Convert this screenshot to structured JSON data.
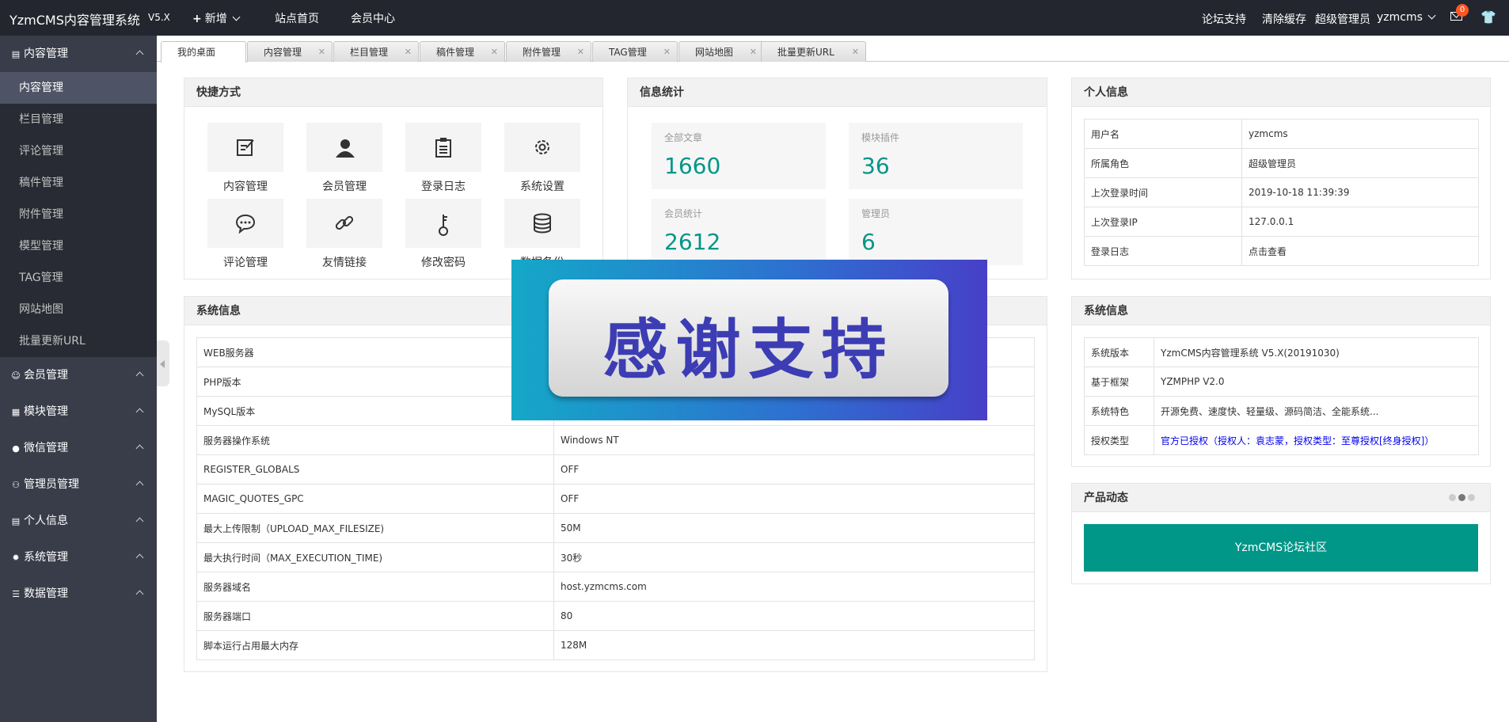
{
  "header": {
    "brand": "YzmCMS内容管理系统",
    "version": "V5.X",
    "nav": [
      "新增",
      "站点首页",
      "会员中心"
    ],
    "right": {
      "forum": "论坛支持",
      "clear_cache": "清除缓存",
      "role": "超级管理员",
      "user": "yzmcms",
      "mail_count": "0"
    }
  },
  "sidebar": {
    "groups": [
      {
        "label": "内容管理",
        "icon": "document-icon"
      },
      {
        "label": "会员管理",
        "icon": "user-icon"
      },
      {
        "label": "模块管理",
        "icon": "grid-icon"
      },
      {
        "label": "微信管理",
        "icon": "wechat-icon"
      },
      {
        "label": "管理员管理",
        "icon": "admin-icon"
      },
      {
        "label": "个人信息",
        "icon": "card-icon"
      },
      {
        "label": "系统管理",
        "icon": "gear-icon"
      },
      {
        "label": "数据管理",
        "icon": "database-icon"
      }
    ],
    "sub_items": [
      "内容管理",
      "栏目管理",
      "评论管理",
      "稿件管理",
      "附件管理",
      "模型管理",
      "TAG管理",
      "网站地图",
      "批量更新URL"
    ]
  },
  "tabs": [
    "我的桌面",
    "内容管理",
    "栏目管理",
    "稿件管理",
    "附件管理",
    "TAG管理",
    "网站地图",
    "批量更新URL"
  ],
  "shortcuts": {
    "title": "快捷方式",
    "items": [
      {
        "label": "内容管理",
        "icon": "edit-icon"
      },
      {
        "label": "会员管理",
        "icon": "user-icon"
      },
      {
        "label": "登录日志",
        "icon": "clipboard-icon"
      },
      {
        "label": "系统设置",
        "icon": "gear-icon"
      },
      {
        "label": "评论管理",
        "icon": "comment-icon"
      },
      {
        "label": "友情链接",
        "icon": "link-icon"
      },
      {
        "label": "修改密码",
        "icon": "key-icon"
      },
      {
        "label": "数据备份",
        "icon": "database-icon"
      }
    ]
  },
  "stats": {
    "title": "信息统计",
    "items": [
      {
        "label": "全部文章",
        "value": "1660"
      },
      {
        "label": "模块插件",
        "value": "36"
      },
      {
        "label": "会员统计",
        "value": "2612"
      },
      {
        "label": "管理员",
        "value": "6"
      }
    ]
  },
  "personal": {
    "title": "个人信息",
    "rows": [
      {
        "k": "用户名",
        "v": "yzmcms"
      },
      {
        "k": "所属角色",
        "v": "超级管理员"
      },
      {
        "k": "上次登录时间",
        "v": "2019-10-18 11:39:39"
      },
      {
        "k": "上次登录IP",
        "v": "127.0.0.1"
      },
      {
        "k": "登录日志",
        "v": "点击查看"
      }
    ]
  },
  "sysinfo": {
    "title": "系统信息",
    "rows": [
      {
        "k": "WEB服务器",
        "v": ""
      },
      {
        "k": "PHP版本",
        "v": ""
      },
      {
        "k": "MySQL版本",
        "v": ""
      },
      {
        "k": "服务器操作系统",
        "v": "Windows NT"
      },
      {
        "k": "REGISTER_GLOBALS",
        "v": "OFF"
      },
      {
        "k": "MAGIC_QUOTES_GPC",
        "v": "OFF"
      },
      {
        "k": "最大上传限制（UPLOAD_MAX_FILESIZE)",
        "v": "50M"
      },
      {
        "k": "最大执行时间（MAX_EXECUTION_TIME)",
        "v": "30秒"
      },
      {
        "k": "服务器域名",
        "v": "host.yzmcms.com"
      },
      {
        "k": "服务器端口",
        "v": "80"
      },
      {
        "k": "脚本运行占用最大内存",
        "v": "128M"
      }
    ]
  },
  "system": {
    "title": "系统信息",
    "rows": [
      {
        "k": "系统版本",
        "v": "YzmCMS内容管理系统 V5.X(20191030)"
      },
      {
        "k": "基于框架",
        "v": "YZMPHP V2.0"
      },
      {
        "k": "系统特色",
        "v": "开源免费、速度快、轻量级、源码简洁、全能系统..."
      },
      {
        "k": "授权类型",
        "v": "官方已授权（授权人：袁志蒙，授权类型：至尊授权[终身授权]）"
      }
    ]
  },
  "news": {
    "title": "产品动态",
    "button": "YzmCMS论坛社区"
  },
  "banner": {
    "text": "感谢支持"
  }
}
